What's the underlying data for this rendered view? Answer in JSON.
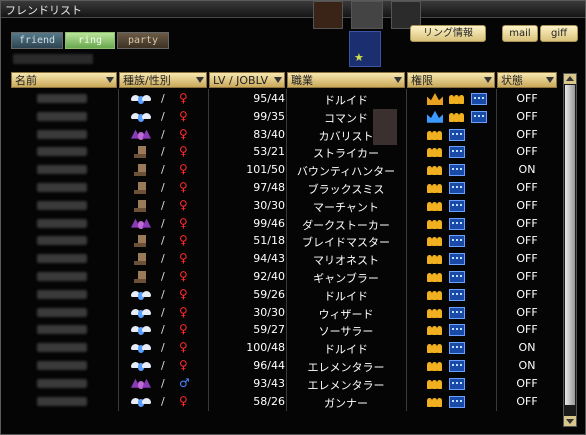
{
  "window": {
    "title": "フレンドリスト"
  },
  "tabs": [
    {
      "label": "friend",
      "active": false
    },
    {
      "label": "ring",
      "active": true
    },
    {
      "label": "party",
      "active": false
    }
  ],
  "buttons": {
    "info": "リング情報",
    "mail": "mail",
    "gift": "giff"
  },
  "columns": [
    "名前",
    "種族/性別",
    "LV / JOBLV",
    "職業",
    "権限",
    "状態"
  ],
  "colors": {
    "header_gradient_top": "#f6e7b0",
    "female": "#ff2a2a",
    "male": "#4a8aff",
    "tab_active": "#8fbf70"
  },
  "rows": [
    {
      "race": "wing-white",
      "sex": "♀",
      "sex_class": "f",
      "lv": "95/44",
      "job": "ドルイド",
      "perms": [
        "crown-orange-icon",
        "people-icon",
        "chat-icon"
      ],
      "status": "OFF"
    },
    {
      "race": "wing-white",
      "sex": "♀",
      "sex_class": "f",
      "lv": "99/35",
      "job": "コマンド",
      "perms": [
        "crown-blue-icon",
        "people-icon",
        "chat-icon"
      ],
      "status": "OFF"
    },
    {
      "race": "wing-purple",
      "sex": "♀",
      "sex_class": "f",
      "lv": "83/40",
      "job": "カバリスト",
      "perms": [
        "people-icon",
        "chat-icon"
      ],
      "status": "OFF"
    },
    {
      "race": "boot",
      "sex": "♀",
      "sex_class": "f",
      "lv": "53/21",
      "job": "ストライカー",
      "perms": [
        "people-icon",
        "chat-icon"
      ],
      "status": "OFF"
    },
    {
      "race": "boot",
      "sex": "♀",
      "sex_class": "f",
      "lv": "101/50",
      "job": "バウンティハンター",
      "perms": [
        "people-icon",
        "chat-icon"
      ],
      "status": "ON"
    },
    {
      "race": "boot",
      "sex": "♀",
      "sex_class": "f",
      "lv": "97/48",
      "job": "ブラックスミス",
      "perms": [
        "people-icon",
        "chat-icon"
      ],
      "status": "OFF"
    },
    {
      "race": "boot",
      "sex": "♀",
      "sex_class": "f",
      "lv": "30/30",
      "job": "マーチャント",
      "perms": [
        "people-icon",
        "chat-icon"
      ],
      "status": "OFF"
    },
    {
      "race": "wing-purple",
      "sex": "♀",
      "sex_class": "f",
      "lv": "99/46",
      "job": "ダークストーカー",
      "perms": [
        "people-icon",
        "chat-icon"
      ],
      "status": "OFF"
    },
    {
      "race": "boot",
      "sex": "♀",
      "sex_class": "f",
      "lv": "51/18",
      "job": "ブレイドマスター",
      "perms": [
        "people-icon",
        "chat-icon"
      ],
      "status": "OFF"
    },
    {
      "race": "boot",
      "sex": "♀",
      "sex_class": "f",
      "lv": "94/43",
      "job": "マリオネスト",
      "perms": [
        "people-icon",
        "chat-icon"
      ],
      "status": "OFF"
    },
    {
      "race": "boot",
      "sex": "♀",
      "sex_class": "f",
      "lv": "92/40",
      "job": "ギャンブラー",
      "perms": [
        "people-icon",
        "chat-icon"
      ],
      "status": "OFF"
    },
    {
      "race": "wing-white",
      "sex": "♀",
      "sex_class": "f",
      "lv": "59/26",
      "job": "ドルイド",
      "perms": [
        "people-icon",
        "chat-icon"
      ],
      "status": "OFF"
    },
    {
      "race": "wing-white",
      "sex": "♀",
      "sex_class": "f",
      "lv": "30/30",
      "job": "ウィザード",
      "perms": [
        "people-icon",
        "chat-icon"
      ],
      "status": "OFF"
    },
    {
      "race": "wing-white",
      "sex": "♀",
      "sex_class": "f",
      "lv": "59/27",
      "job": "ソーサラー",
      "perms": [
        "people-icon",
        "chat-icon"
      ],
      "status": "OFF"
    },
    {
      "race": "wing-white",
      "sex": "♀",
      "sex_class": "f",
      "lv": "100/48",
      "job": "ドルイド",
      "perms": [
        "people-icon",
        "chat-icon"
      ],
      "status": "ON"
    },
    {
      "race": "wing-white",
      "sex": "♀",
      "sex_class": "f",
      "lv": "96/44",
      "job": "エレメンタラー",
      "perms": [
        "people-icon",
        "chat-icon"
      ],
      "status": "ON"
    },
    {
      "race": "wing-purple",
      "sex": "♂",
      "sex_class": "m",
      "lv": "93/43",
      "job": "エレメンタラー",
      "perms": [
        "people-icon",
        "chat-icon"
      ],
      "status": "OFF"
    },
    {
      "race": "wing-white",
      "sex": "♀",
      "sex_class": "f",
      "lv": "58/26",
      "job": "ガンナー",
      "perms": [
        "people-icon",
        "chat-icon"
      ],
      "status": "OFF"
    }
  ]
}
